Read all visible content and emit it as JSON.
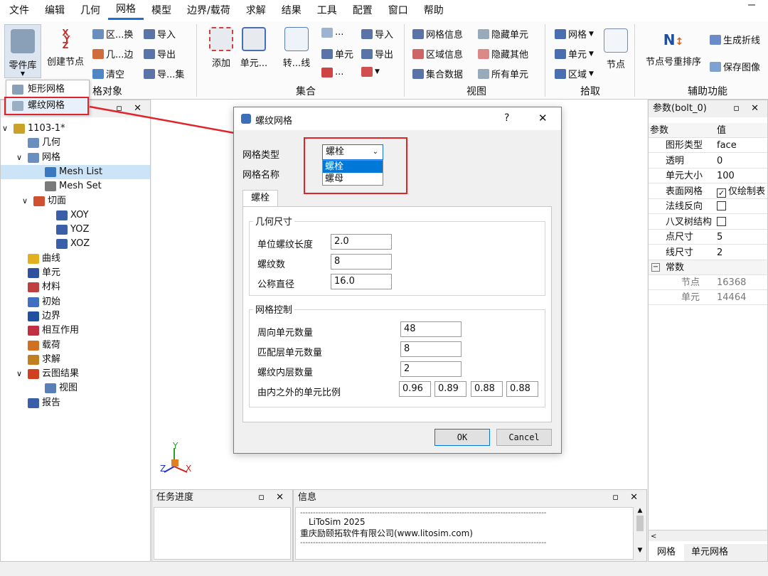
{
  "menu": [
    "文件",
    "编辑",
    "几何",
    "网格",
    "模型",
    "边界/载荷",
    "求解",
    "结果",
    "工具",
    "配置",
    "窗口",
    "帮助"
  ],
  "ribbon": {
    "part_library": "零件库",
    "create_node": "创建节点",
    "col3": [
      "区...换",
      "几...边",
      "清空"
    ],
    "col4": [
      "导入",
      "导出",
      "导...集"
    ],
    "mesh_objects_group": "格对象",
    "add": "添加",
    "element": "单元...",
    "convert": "转...线",
    "set_col1": [
      "...",
      "单元",
      "..."
    ],
    "set_col2": [
      "导入",
      "导出",
      ""
    ],
    "set_group": "集合",
    "view_col1": [
      "网格信息",
      "区域信息",
      "集合数据"
    ],
    "view_col2": [
      "隐藏单元",
      "隐藏其他",
      "所有单元"
    ],
    "view_group": "视图",
    "pick_col": [
      "网格",
      "单元",
      "区域"
    ],
    "node": "节点",
    "pick_group": "拾取",
    "renumber": "节点号重排序",
    "polyline": "生成折线",
    "save_image": "保存图像",
    "aux_group": "辅助功能"
  },
  "dropdown": {
    "items": [
      "矩形网格",
      "螺纹网格"
    ]
  },
  "tree": {
    "rows": [
      "1103-1*",
      "几何",
      "网格",
      "Mesh List",
      "Mesh Set",
      "切面",
      "XOY",
      "YOZ",
      "XOZ",
      "曲线",
      "单元",
      "材料",
      "初始",
      "边界",
      "相互作用",
      "载荷",
      "求解",
      "云图结果",
      "视图",
      "报告"
    ]
  },
  "dialog": {
    "title": "螺纹网格",
    "help": "?",
    "close": "✕",
    "mesh_type_label": "网格类型",
    "mesh_type_value": "螺栓",
    "mesh_name_label": "网格名称",
    "options": [
      "螺栓",
      "螺母"
    ],
    "tab": "螺栓",
    "geo_group": "几何尺寸",
    "geo": [
      {
        "label": "单位螺纹长度",
        "value": "2.0"
      },
      {
        "label": "螺纹数",
        "value": "8"
      },
      {
        "label": "公称直径",
        "value": "16.0"
      }
    ],
    "ctrl_group": "网格控制",
    "ctrl": [
      {
        "label": "周向单元数量",
        "value": "48"
      },
      {
        "label": "匹配层单元数量",
        "value": "8"
      },
      {
        "label": "螺纹内层数量",
        "value": "2"
      }
    ],
    "ratio_label": "由内之外的单元比例",
    "ratios": [
      "0.96",
      "0.89",
      "0.88",
      "0.88"
    ],
    "ok": "OK",
    "cancel": "Cancel"
  },
  "props": {
    "title": "参数(bolt_0)",
    "col_param": "参数",
    "col_value": "值",
    "rows": [
      {
        "k": "图形类型",
        "v": "face"
      },
      {
        "k": "透明",
        "v": "0"
      },
      {
        "k": "单元大小",
        "v": "100"
      },
      {
        "k": "表面网格",
        "v": "仅绘制表"
      },
      {
        "k": "法线反向",
        "v": ""
      },
      {
        "k": "八叉树结构",
        "v": ""
      },
      {
        "k": "点尺寸",
        "v": "5"
      },
      {
        "k": "线尺寸",
        "v": "2"
      }
    ],
    "const_group": "常数",
    "consts": [
      {
        "k": "节点",
        "v": "16368"
      },
      {
        "k": "单元",
        "v": "14464"
      }
    ],
    "tabs": [
      "网格",
      "单元网格"
    ]
  },
  "task": {
    "title": "任务进度"
  },
  "info": {
    "title": "信息",
    "line1": "LiToSim 2025",
    "line2": "重庆励颐拓软件有限公司(www.litosim.com)",
    "sep": "------------------------------------------------------------------------------------------------"
  },
  "axis": {
    "y": "Y",
    "z": "Z",
    "x": "X"
  },
  "colors": {
    "accent": "#1a6fd8",
    "highlight": "#e0242c",
    "selection": "#0078d7"
  }
}
